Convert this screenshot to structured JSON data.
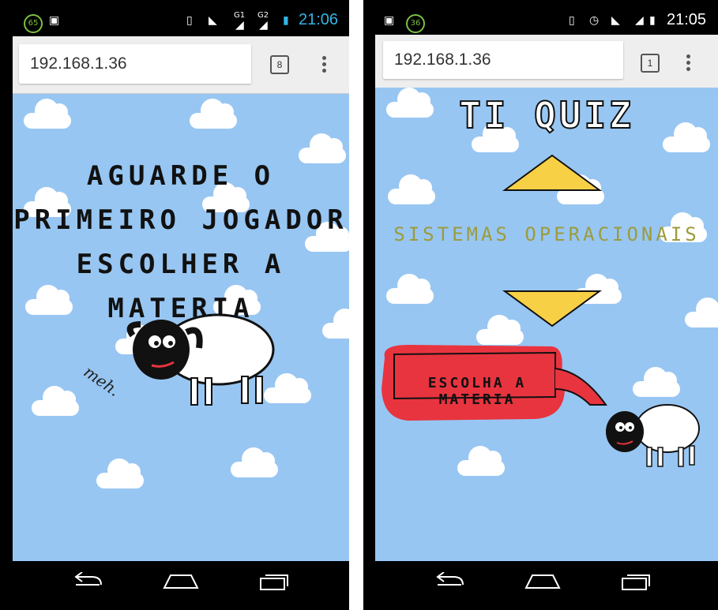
{
  "left": {
    "status": {
      "notif1": "65",
      "time": "21:06",
      "sim1": "G1",
      "sim2": "G2"
    },
    "address": {
      "url": "192.168.1.36",
      "tabs": "8"
    },
    "message_lines": [
      "AGUARDE O",
      "PRIMEIRO JOGADOR",
      "ESCOLHER A MATERIA"
    ],
    "sheep_caption": "meh."
  },
  "right": {
    "status": {
      "notif1": "36",
      "time": "21:05"
    },
    "address": {
      "url": "192.168.1.36",
      "tabs": "1"
    },
    "title": "TI QUIZ",
    "subject": "SISTEMAS OPERACIONAIS",
    "choose_button": "ESCOLHA A MATERIA"
  },
  "colors": {
    "sky": "#98c6f2",
    "arrow": "#f7d046",
    "button": "#e8343f",
    "subject": "#9c9c3c",
    "time_left": "#33b5e5"
  }
}
